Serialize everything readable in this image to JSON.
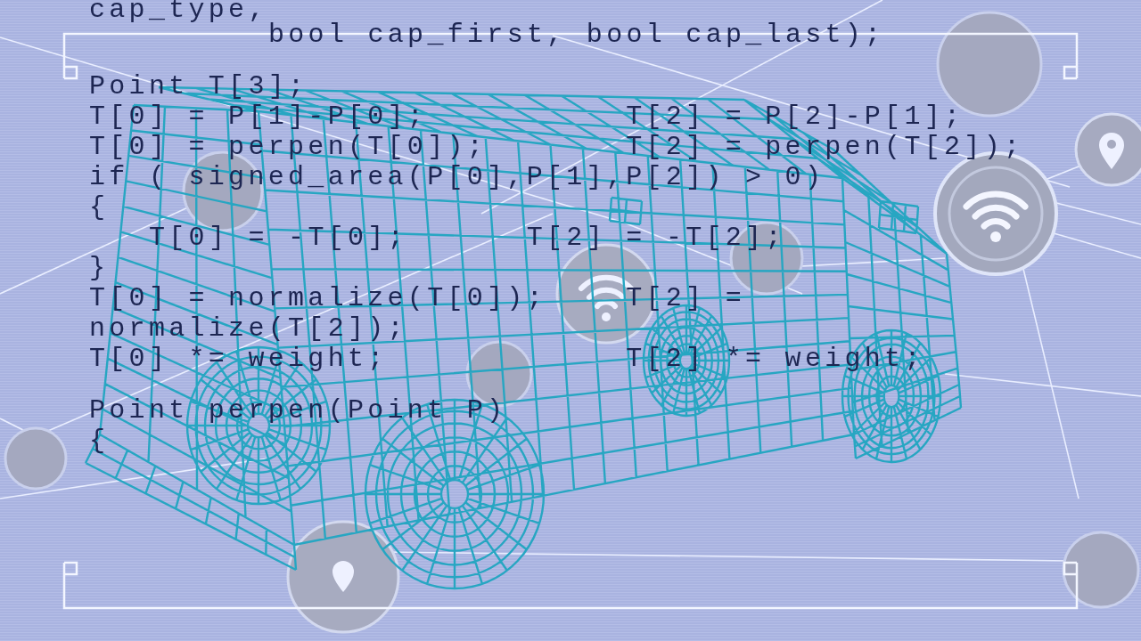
{
  "code": {
    "blocks": [
      {
        "lines": [
          {
            "kind": "statement",
            "text": "cap_type,"
          },
          {
            "kind": "continuation",
            "text": "bool cap_first, bool cap_last);"
          }
        ]
      },
      {
        "lines": [
          {
            "kind": "statement",
            "text": "Point T[3];"
          },
          {
            "kind": "statement",
            "text": "T[0] = P[1]-P[0];          T[2] = P[2]-P[1];"
          },
          {
            "kind": "statement",
            "text": "T[0] = perpen(T[0]);       T[2] = perpen(T[2]);"
          },
          {
            "kind": "statement",
            "text": "if ( signed_area(P[0],P[1],P[2]) > 0)"
          },
          {
            "kind": "statement",
            "text": "{",
            "children": [
              {
                "kind": "statement",
                "text": "T[0] = -T[0];      T[2] = -T[2];"
              }
            ]
          },
          {
            "kind": "statement",
            "text": "}"
          },
          {
            "kind": "statement",
            "text": "T[0] = normalize(T[0]);    T[2] ="
          },
          {
            "kind": "statement",
            "text": "normalize(T[2]);"
          },
          {
            "kind": "statement",
            "text": "T[0] *= weight;            T[2] *= weight;"
          }
        ]
      },
      {
        "lines": [
          {
            "kind": "statement",
            "text": "Point perpen(Point P)"
          },
          {
            "kind": "statement",
            "text": "{"
          }
        ]
      }
    ]
  }
}
